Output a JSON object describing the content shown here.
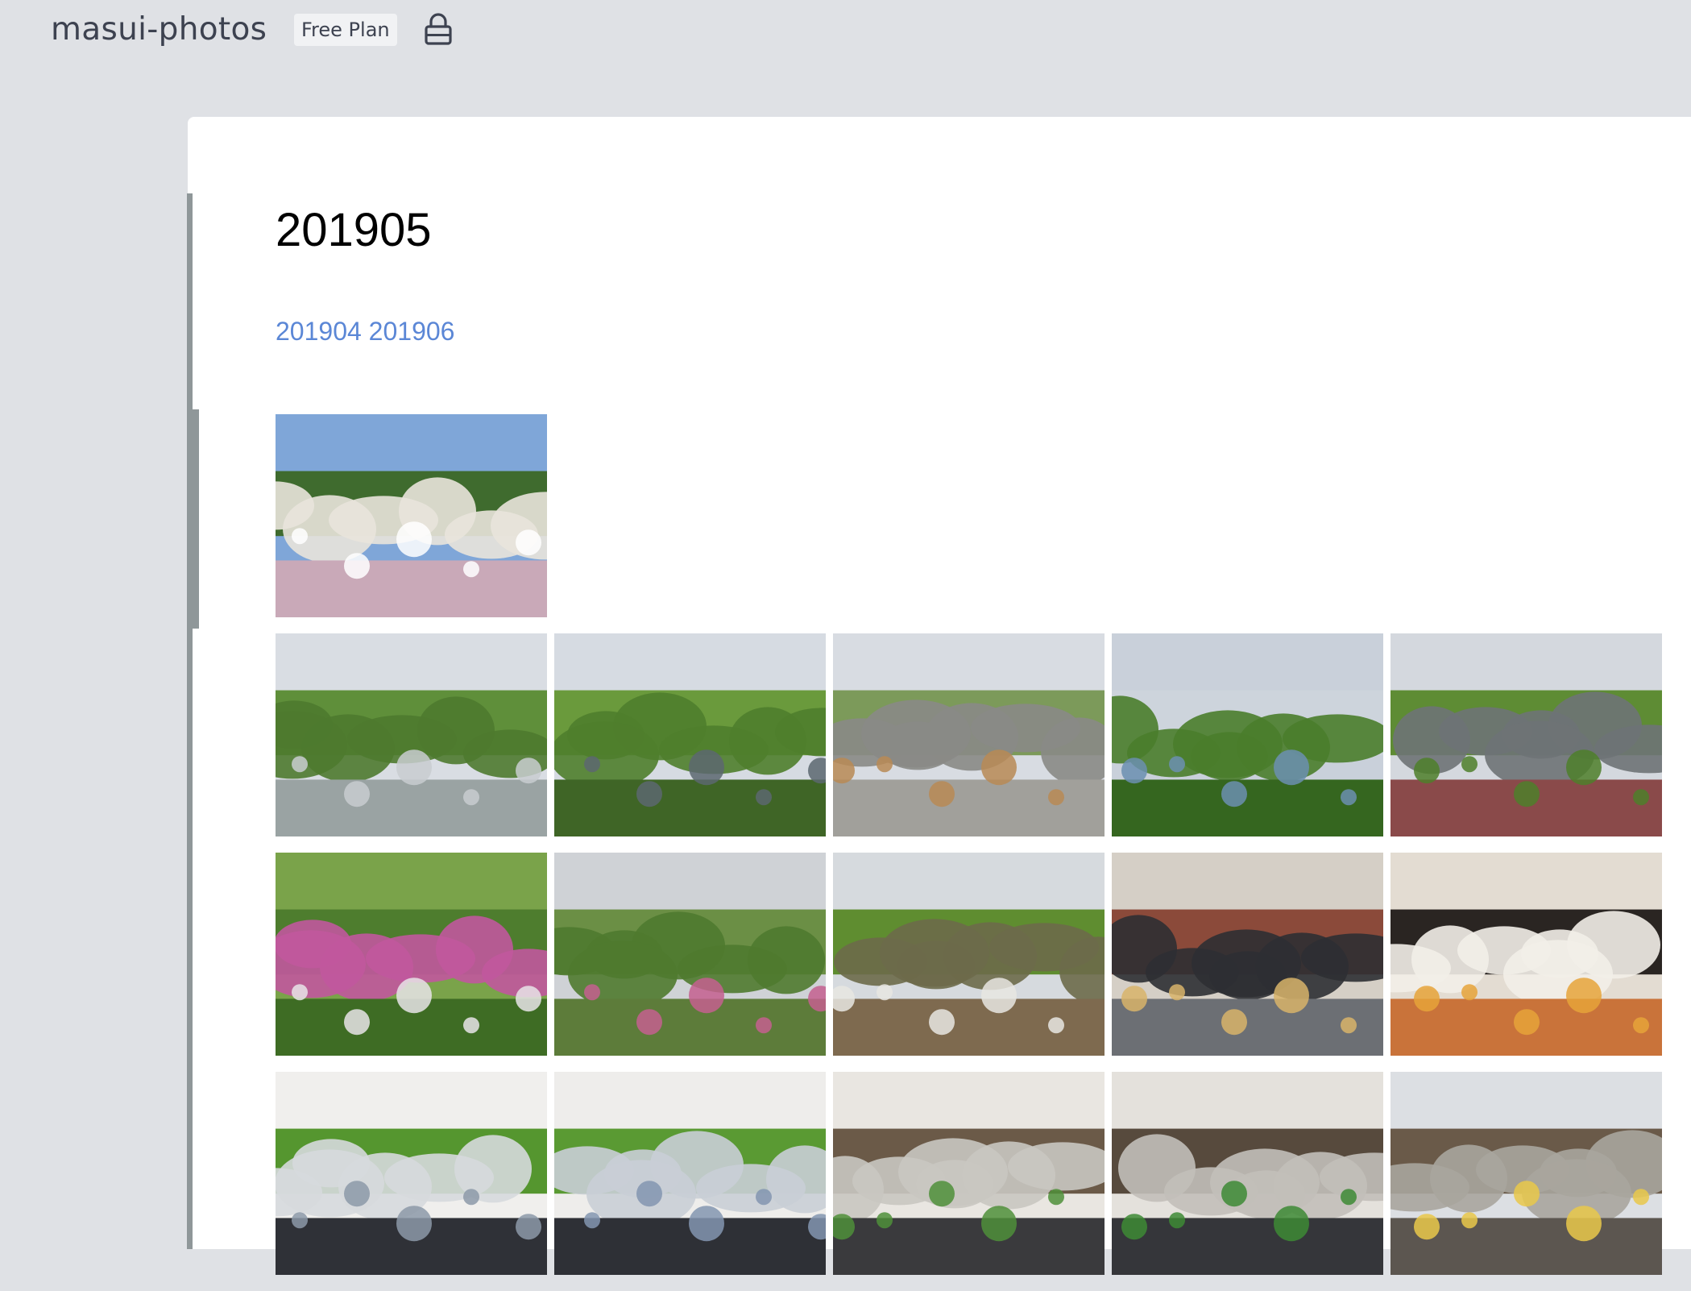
{
  "header": {
    "project_name": "masui-photos",
    "plan_badge": "Free Plan",
    "lock_icon": "lock-icon"
  },
  "page": {
    "title": "201905",
    "links": [
      {
        "label": "201904"
      },
      {
        "label": "201906"
      }
    ]
  },
  "colors": {
    "background": "#dfe1e5",
    "card": "#ffffff",
    "link": "#5b87d6",
    "text": "#3d4250",
    "sidebar_bar": "#8f9799"
  },
  "gallery": {
    "rows": [
      [
        {
          "subject": "white-roses",
          "sky": "#7fa6d8",
          "top": "#3f6b2e",
          "mid": "#e9e4dc",
          "bottom": "#c9a9b8",
          "accent": "#ffffff"
        }
      ],
      [
        {
          "subject": "tree-railing",
          "sky": "#d9dde3",
          "top": "#5f8f3a",
          "mid": "#4e7a2f",
          "bottom": "#9aa3a3",
          "accent": "#c8cdd0"
        },
        {
          "subject": "forest-building",
          "sky": "#d6dbe2",
          "top": "#6a9a3c",
          "mid": "#4f7e2c",
          "bottom": "#3f6526",
          "accent": "#5c6770"
        },
        {
          "subject": "picnic-terrace",
          "sky": "#d8dce2",
          "top": "#7c9a5a",
          "mid": "#8a8a86",
          "bottom": "#a1a09b",
          "accent": "#b88a55"
        },
        {
          "subject": "forest-view",
          "sky": "#c9d0da",
          "top": "#cdd4dc",
          "mid": "#4a7d2b",
          "bottom": "#35661f",
          "accent": "#6b8fb0"
        },
        {
          "subject": "path-trees",
          "sky": "#d4d8de",
          "top": "#5e8c34",
          "mid": "#6e7375",
          "bottom": "#8a4a4a",
          "accent": "#4d7f2a"
        }
      ],
      [
        {
          "subject": "azaleas",
          "sky": "#7aa34a",
          "top": "#4e7d2e",
          "mid": "#c1589d",
          "bottom": "#3e6c24",
          "accent": "#e7e4e8"
        },
        {
          "subject": "valley-forest",
          "sky": "#cfd2d6",
          "top": "#6b8f45",
          "mid": "#4f7a2f",
          "bottom": "#5d7c3a",
          "accent": "#c4608f"
        },
        {
          "subject": "hillside-sign",
          "sky": "#d6dade",
          "top": "#5f8d30",
          "mid": "#6d6a4a",
          "bottom": "#7e6a4f",
          "accent": "#e8e6e2"
        },
        {
          "subject": "shop-entrance",
          "sky": "#d5cfc6",
          "top": "#8b4a3a",
          "mid": "#2d2f33",
          "bottom": "#6c6f74",
          "accent": "#d8b46a"
        },
        {
          "subject": "ramen-bowl",
          "sky": "#e3dcd2",
          "top": "#2a2522",
          "mid": "#f2eee8",
          "bottom": "#c9733a",
          "accent": "#e6a33a"
        }
      ],
      [
        {
          "subject": "crowd-plaza",
          "sky": "#f0efed",
          "top": "#55962f",
          "mid": "#d6d9dd",
          "bottom": "#2f3137",
          "accent": "#8c99a8"
        },
        {
          "subject": "crowd-plaza-2",
          "sky": "#eeedeb",
          "top": "#5a9a33",
          "mid": "#c9ced6",
          "bottom": "#2e3036",
          "accent": "#8395b0"
        },
        {
          "subject": "station-crowd",
          "sky": "#e9e6e1",
          "top": "#6b5a48",
          "mid": "#c9c6c1",
          "bottom": "#3a3a3d",
          "accent": "#4f8f3a"
        },
        {
          "subject": "station-crowd-2",
          "sky": "#e4e1dc",
          "top": "#574a3d",
          "mid": "#c2bfb9",
          "bottom": "#35363a",
          "accent": "#3d8a35"
        },
        {
          "subject": "train-platform",
          "sky": "#dcdfe3",
          "top": "#6a5a49",
          "mid": "#a9a59d",
          "bottom": "#5c5650",
          "accent": "#e9c84a"
        }
      ]
    ]
  }
}
